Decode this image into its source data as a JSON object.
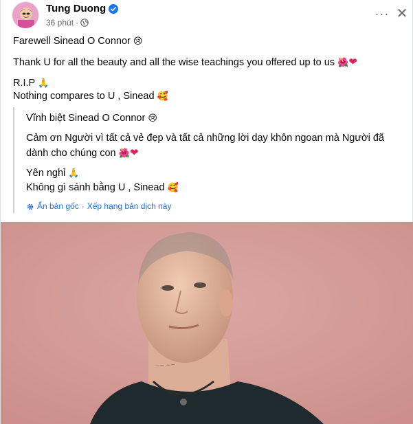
{
  "header": {
    "author_name": "Tung Duong",
    "timestamp": "36 phút",
    "separator": "·",
    "more_label": "···",
    "close_label": "✕"
  },
  "post": {
    "line1": "Farewell Sinead O Connor",
    "line1_emoji": "😢",
    "line2": "Thank U for all the beauty and all the wise teachings you offered up to us",
    "line2_emoji_rose": "🌺",
    "line2_emoji_heart": "❤",
    "line3": "R.I.P",
    "line3_emoji": "🙏",
    "line4": "Nothing compares to U , Sinead",
    "line4_emoji": "🥰"
  },
  "translation": {
    "line1": "Vĩnh biệt Sinead O Connor",
    "line1_emoji": "😢",
    "line2": "Cảm ơn Người vì tất cả vẻ đẹp và tất cả những lời dạy khôn ngoan mà Người đã dành cho chúng con",
    "line2_emoji_rose": "🌺",
    "line2_emoji_heart": "❤",
    "line3": "Yên nghỉ",
    "line3_emoji": "🙏",
    "line4": "Không gì sánh bằng U , Sinead",
    "line4_emoji": "🥰",
    "show_original": "Ẩn bản gốc",
    "separator": "·",
    "rate_translation": "Xếp hạng bản dịch này"
  },
  "icons": {
    "verified": "verified-badge-icon",
    "globe": "globe-icon",
    "gear": "gear-icon",
    "more": "more-icon",
    "close": "close-icon"
  },
  "colors": {
    "link": "#216fdb",
    "meta": "#65676b",
    "verified": "#1877f2",
    "photo_background": "#d49a96"
  }
}
